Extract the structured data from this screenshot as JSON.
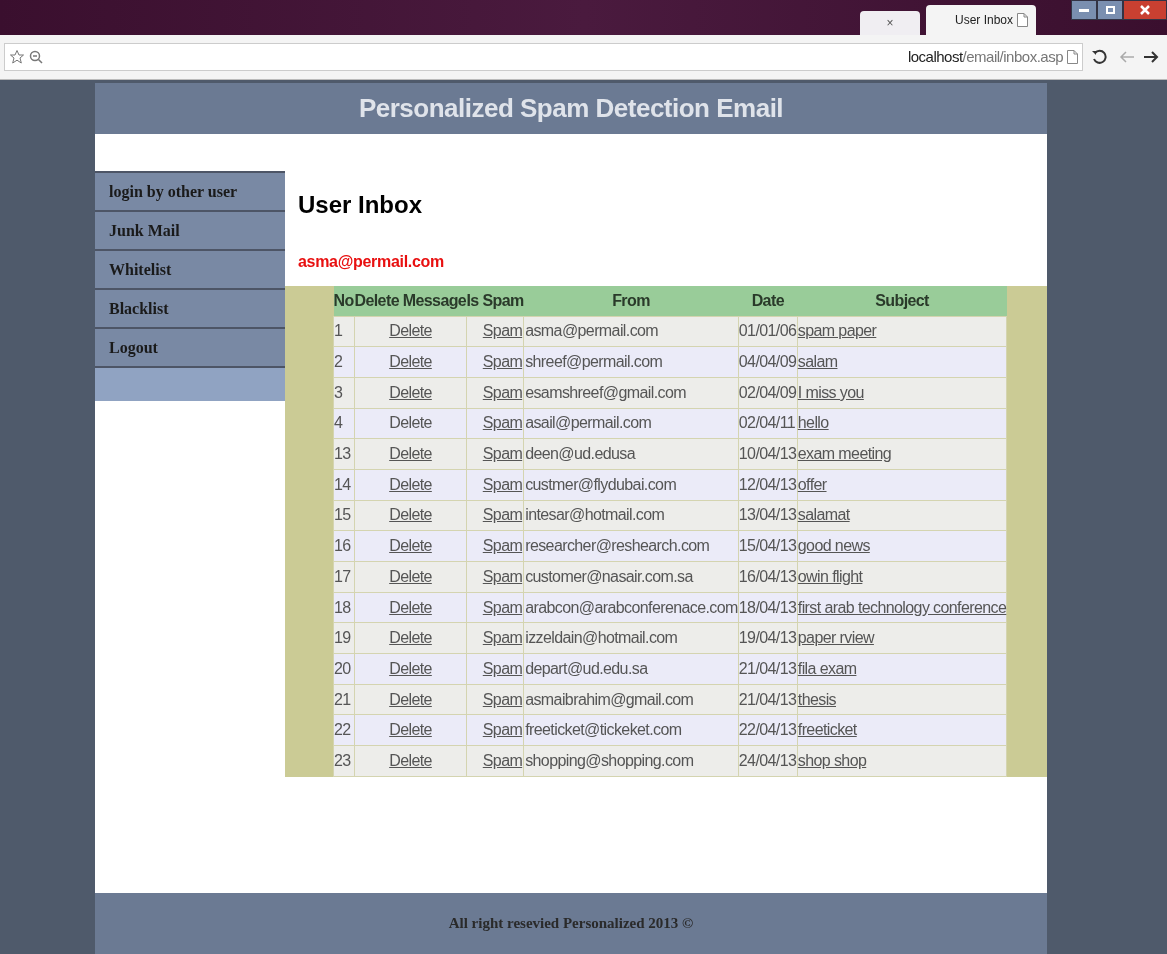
{
  "browser": {
    "tabs": [
      {
        "label": "×",
        "selected": false
      },
      {
        "label": "User Inbox",
        "selected": true
      }
    ],
    "url_host": "localhost",
    "url_path": "/email/inbox.asp"
  },
  "header": {
    "title": "Personalized Spam Detection Email"
  },
  "sidebar": {
    "items": [
      {
        "label": "login by other user"
      },
      {
        "label": "Junk Mail"
      },
      {
        "label": "Whitelist"
      },
      {
        "label": "Blacklist"
      },
      {
        "label": "Logout"
      }
    ]
  },
  "main": {
    "title": "User Inbox",
    "user_email": "asma@permail.com"
  },
  "table": {
    "columns": [
      "No",
      "Delete Message",
      "Is Spam",
      "From",
      "Date",
      "Subject"
    ],
    "rows": [
      {
        "no": "1",
        "delete": "Delete",
        "delete_link": true,
        "spam": "Spam",
        "from": "asma@permail.com",
        "date": "01/01/06",
        "subject": "spam paper"
      },
      {
        "no": "2",
        "delete": "Delete",
        "delete_link": true,
        "spam": "Spam",
        "from": "shreef@permail.com",
        "date": "04/04/09",
        "subject": "salam"
      },
      {
        "no": "3",
        "delete": "Delete",
        "delete_link": true,
        "spam": "Spam",
        "from": "esamshreef@gmail.com",
        "date": "02/04/09",
        "subject": "I miss you"
      },
      {
        "no": "4",
        "delete": "Delete",
        "delete_link": false,
        "spam": "Spam",
        "from": "asail@permail.com",
        "date": "02/04/11",
        "subject": "hello"
      },
      {
        "no": "13",
        "delete": "Delete",
        "delete_link": true,
        "spam": "Spam",
        "from": "deen@ud.edusa",
        "date": "10/04/13",
        "subject": "exam meeting"
      },
      {
        "no": "14",
        "delete": "Delete",
        "delete_link": true,
        "spam": "Spam",
        "from": "custmer@flydubai.com",
        "date": "12/04/13",
        "subject": "offer"
      },
      {
        "no": "15",
        "delete": "Delete",
        "delete_link": true,
        "spam": "Spam",
        "from": "intesar@hotmail.com",
        "date": "13/04/13",
        "subject": "salamat"
      },
      {
        "no": "16",
        "delete": "Delete",
        "delete_link": true,
        "spam": "Spam",
        "from": "researcher@reshearch.com",
        "date": "15/04/13",
        "subject": "good news"
      },
      {
        "no": "17",
        "delete": "Delete",
        "delete_link": true,
        "spam": "Spam",
        "from": "customer@nasair.com.sa",
        "date": "16/04/13",
        "subject": "owin flight"
      },
      {
        "no": "18",
        "delete": "Delete",
        "delete_link": true,
        "spam": "Spam",
        "from": "arabcon@arabconferenace.com",
        "date": "18/04/13",
        "subject": "first arab technology conference"
      },
      {
        "no": "19",
        "delete": "Delete",
        "delete_link": true,
        "spam": "Spam",
        "from": "izzeldain@hotmail.com",
        "date": "19/04/13",
        "subject": "paper rview"
      },
      {
        "no": "20",
        "delete": "Delete",
        "delete_link": true,
        "spam": "Spam",
        "from": "depart@ud.edu.sa",
        "date": "21/04/13",
        "subject": "fila exam"
      },
      {
        "no": "21",
        "delete": "Delete",
        "delete_link": true,
        "spam": "Spam",
        "from": "asmaibrahim@gmail.com",
        "date": "21/04/13",
        "subject": "thesis"
      },
      {
        "no": "22",
        "delete": "Delete",
        "delete_link": true,
        "spam": "Spam",
        "from": "freeticket@tickeket.com",
        "date": "22/04/13",
        "subject": "freeticket"
      },
      {
        "no": "23",
        "delete": "Delete",
        "delete_link": true,
        "spam": "Spam",
        "from": "shopping@shopping.com",
        "date": "24/04/13",
        "subject": "shop shop"
      }
    ]
  },
  "footer": {
    "text": "All right resevied Personalized 2013 ©"
  }
}
